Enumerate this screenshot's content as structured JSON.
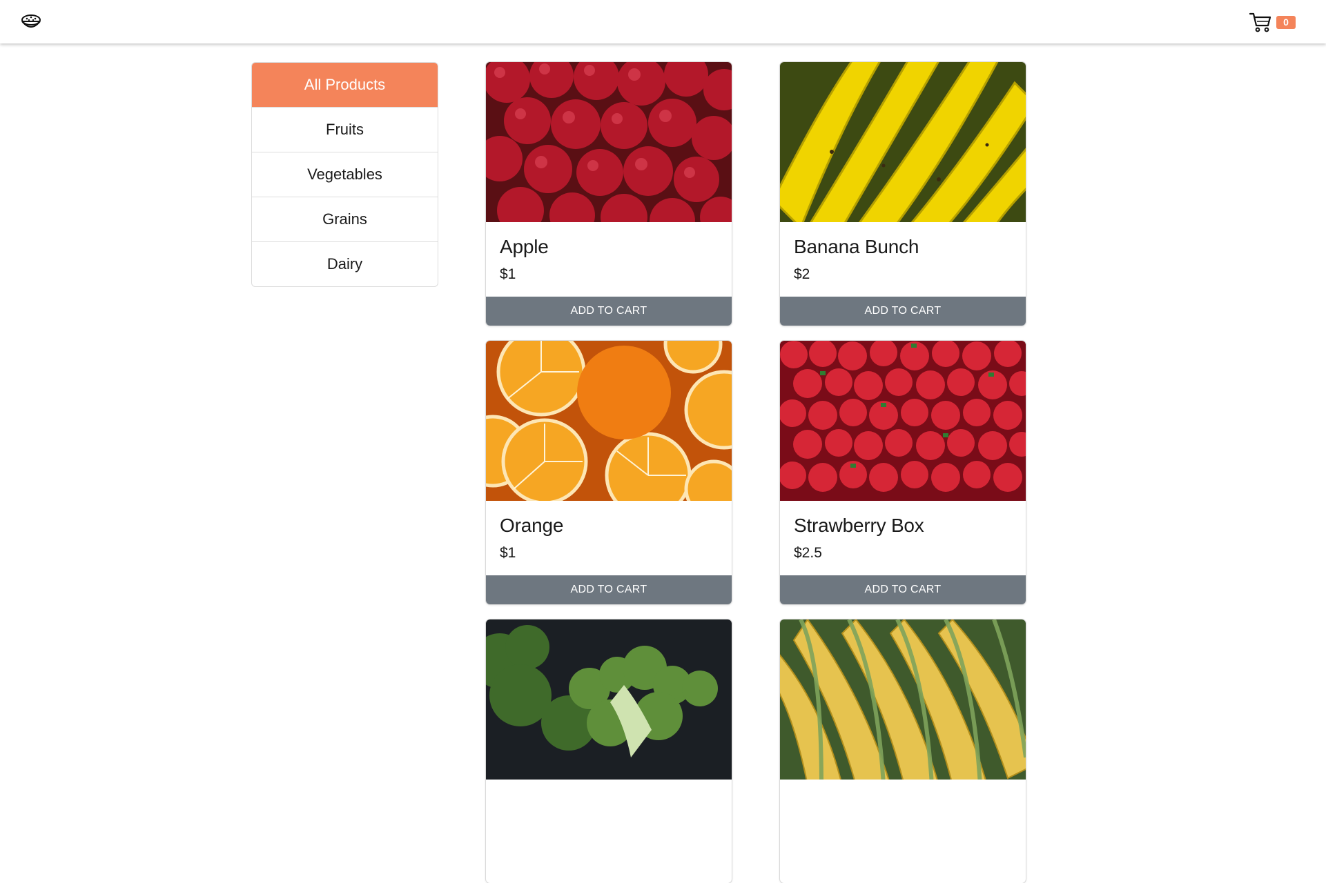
{
  "header": {
    "logo_icon": "food-bowl-icon",
    "cart_icon": "shopping-cart-icon",
    "cart_count": "0",
    "accent_color": "#f4845a"
  },
  "categories": [
    {
      "label": "All Products",
      "active": true
    },
    {
      "label": "Fruits",
      "active": false
    },
    {
      "label": "Vegetables",
      "active": false
    },
    {
      "label": "Grains",
      "active": false
    },
    {
      "label": "Dairy",
      "active": false
    }
  ],
  "products": [
    {
      "name": "Apple",
      "price": "$1",
      "button": "ADD TO CART",
      "image": "apples-photo"
    },
    {
      "name": "Banana Bunch",
      "price": "$2",
      "button": "ADD TO CART",
      "image": "bananas-photo"
    },
    {
      "name": "Orange",
      "price": "$1",
      "button": "ADD TO CART",
      "image": "oranges-photo"
    },
    {
      "name": "Strawberry Box",
      "price": "$2.5",
      "button": "ADD TO CART",
      "image": "strawberries-photo"
    },
    {
      "image": "broccoli-photo"
    },
    {
      "image": "corn-photo"
    }
  ],
  "colors": {
    "button_bg": "#6e7780",
    "active_category_bg": "#f4845a"
  }
}
